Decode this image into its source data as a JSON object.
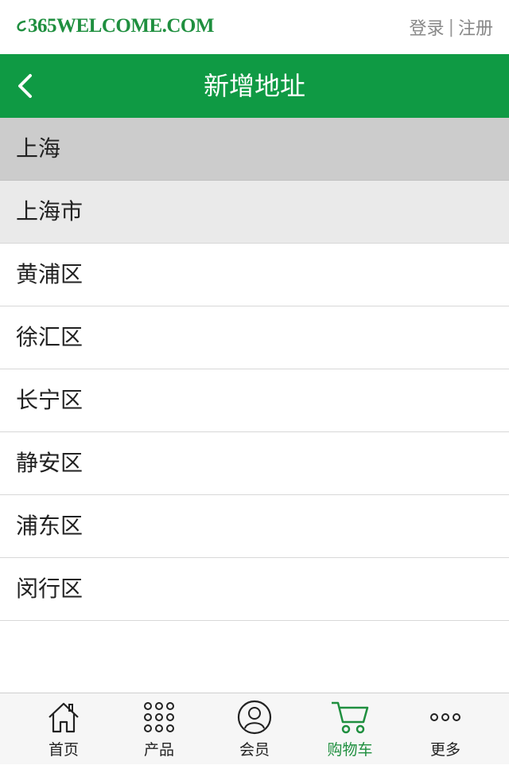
{
  "topbar": {
    "logo_text": "365WELCOME.COM",
    "login": "登录",
    "separator": "|",
    "register": "注册"
  },
  "header": {
    "title": "新增地址",
    "back_icon": "chevron-left-icon"
  },
  "list": {
    "province": "上海",
    "city": "上海市",
    "districts": [
      "黄浦区",
      "徐汇区",
      "长宁区",
      "静安区",
      "浦东区",
      "闵行区"
    ]
  },
  "tabbar": {
    "items": [
      {
        "label": "首页",
        "icon": "home-icon"
      },
      {
        "label": "产品",
        "icon": "grid-icon"
      },
      {
        "label": "会员",
        "icon": "user-icon"
      },
      {
        "label": "购物车",
        "icon": "cart-icon",
        "active": true
      },
      {
        "label": "更多",
        "icon": "more-icon"
      }
    ]
  },
  "colors": {
    "brand_green": "#0f9a44",
    "selected_province_bg": "#cccccc",
    "selected_city_bg": "#eaeaea"
  }
}
